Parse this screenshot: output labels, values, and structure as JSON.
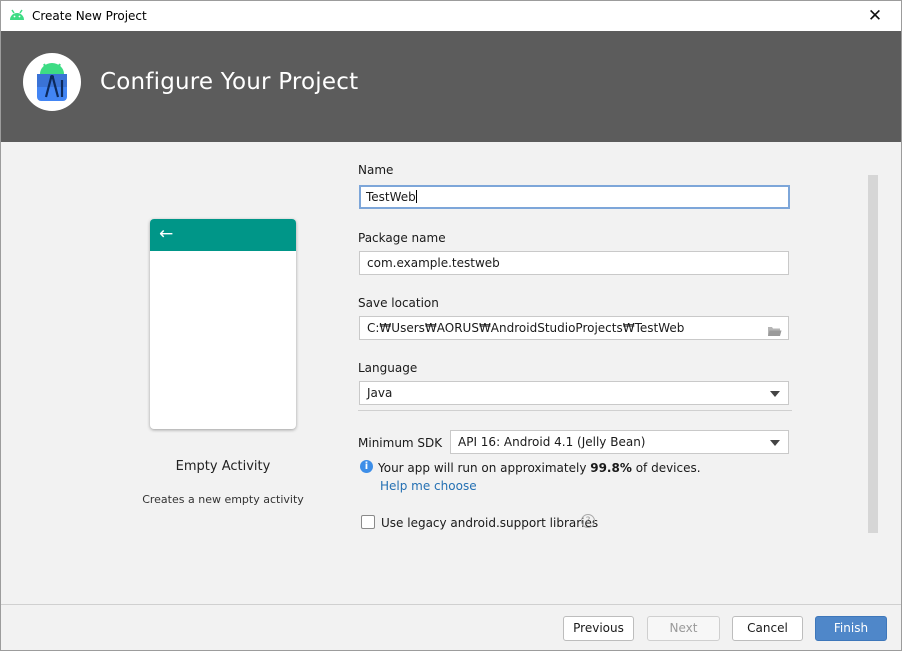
{
  "window": {
    "title": "Create New Project",
    "close_glyph": "✕"
  },
  "header": {
    "title": "Configure Your Project"
  },
  "preview": {
    "back_glyph": "←",
    "name": "Empty Activity",
    "description": "Creates a new empty activity",
    "appbar_color": "#009688"
  },
  "form": {
    "name": {
      "label": "Name",
      "value": "TestWeb"
    },
    "package": {
      "label": "Package name",
      "value": "com.example.testweb"
    },
    "save_location": {
      "label": "Save location",
      "value": "C:₩Users₩AORUS₩AndroidStudioProjects₩TestWeb"
    },
    "language": {
      "label": "Language",
      "value": "Java"
    },
    "min_sdk": {
      "label": "Minimum SDK",
      "value": "API 16: Android 4.1 (Jelly Bean)"
    },
    "info": {
      "prefix": "Your app will run on approximately ",
      "percent": "99.8%",
      "suffix": " of devices.",
      "link": "Help me choose"
    },
    "legacy": {
      "label": "Use legacy android.support libraries",
      "checked": false,
      "help_glyph": "?"
    }
  },
  "buttons": {
    "previous": "Previous",
    "next": "Next",
    "cancel": "Cancel",
    "finish": "Finish"
  },
  "colors": {
    "accent": "#4f87c9",
    "header_bg": "#5c5c5c",
    "link": "#2470b3"
  }
}
